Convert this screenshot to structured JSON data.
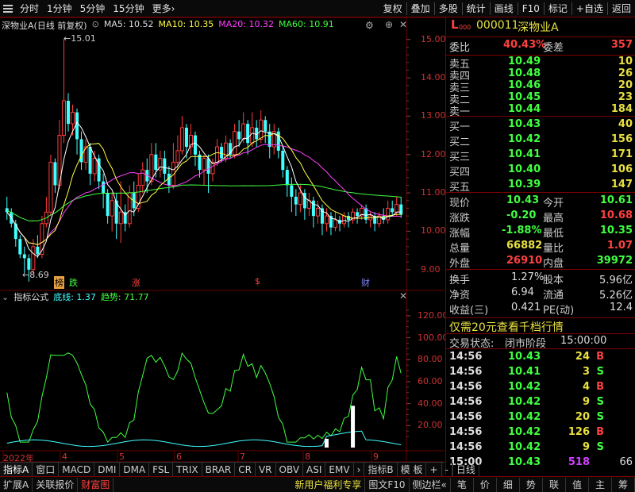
{
  "toolbar": {
    "left": [
      "分时",
      "1分钟",
      "5分钟",
      "15分钟",
      "更多"
    ],
    "more_arrow": "›",
    "right": [
      "复权",
      "叠加",
      "多股",
      "统计",
      "画线",
      "F10",
      "标记",
      "+自选",
      "返回"
    ]
  },
  "main_header": {
    "name": "深物业A(日线 前复权)",
    "ma5": "MA5: 10.52",
    "ma10": "MA10: 10.35",
    "ma20": "MA20: 10.32",
    "ma60": "MA60: 10.91"
  },
  "price_axis": [
    "15.00",
    "14.00",
    "13.00",
    "12.00",
    "11.00",
    "10.00",
    "9.00"
  ],
  "ind_axis": [
    "120.00",
    "100.00",
    "80.00",
    "60.00",
    "40.00",
    "20.00"
  ],
  "x_axis": [
    "2022年",
    "4",
    "5",
    "6",
    "7",
    "8",
    "9"
  ],
  "high_label": "15.01",
  "low_label": "8.69",
  "events": [
    {
      "text": "榜",
      "color": "#000",
      "bg": "#e8a040"
    },
    {
      "text": "跌",
      "color": "#40ff40",
      "bg": ""
    },
    {
      "text": "涨",
      "color": "#ff4040",
      "bg": ""
    },
    {
      "text": "$",
      "color": "#ff4040",
      "bg": ""
    },
    {
      "text": "财",
      "color": "#8080ff",
      "bg": ""
    }
  ],
  "indicator_header": {
    "name": "指标公式",
    "line1": "底线: 1.37",
    "line2": "趋势: 71.77"
  },
  "quote": {
    "code": "000011",
    "name": "深物业A",
    "tag": "L",
    "tag_sub": "000",
    "weibi_label": "委比",
    "weibi": "40.43%",
    "weicha_label": "委差",
    "weicha": "357",
    "sells": [
      {
        "label": "卖五",
        "price": "10.49",
        "vol": "10"
      },
      {
        "label": "卖四",
        "price": "10.48",
        "vol": "26"
      },
      {
        "label": "卖三",
        "price": "10.46",
        "vol": "20"
      },
      {
        "label": "卖二",
        "price": "10.45",
        "vol": "23"
      },
      {
        "label": "卖一",
        "price": "10.44",
        "vol": "184"
      }
    ],
    "buys": [
      {
        "label": "买一",
        "price": "10.43",
        "vol": "40"
      },
      {
        "label": "买二",
        "price": "10.42",
        "vol": "156"
      },
      {
        "label": "买三",
        "price": "10.41",
        "vol": "171"
      },
      {
        "label": "买四",
        "price": "10.40",
        "vol": "106"
      },
      {
        "label": "买五",
        "price": "10.39",
        "vol": "147"
      }
    ],
    "stats": [
      {
        "l1": "现价",
        "v1": "10.43",
        "c1": "#40ff40",
        "l2": "今开",
        "v2": "10.61",
        "c2": "#40ff40"
      },
      {
        "l1": "涨跌",
        "v1": "-0.20",
        "c1": "#40ff40",
        "l2": "最高",
        "v2": "10.68",
        "c2": "#ff4040"
      },
      {
        "l1": "涨幅",
        "v1": "-1.88%",
        "c1": "#40ff40",
        "l2": "最低",
        "v2": "10.35",
        "c2": "#40ff40"
      },
      {
        "l1": "总量",
        "v1": "66882",
        "c1": "#e8e040",
        "l2": "量比",
        "v2": "1.07",
        "c2": "#ff4040"
      },
      {
        "l1": "外盘",
        "v1": "26910",
        "c1": "#ff4040",
        "l2": "内盘",
        "v2": "39972",
        "c2": "#40ff40"
      }
    ],
    "stats2": [
      {
        "l1": "换手",
        "v1": "1.27%",
        "l2": "股本",
        "v2": "5.96亿"
      },
      {
        "l1": "净资",
        "v1": "6.94",
        "l2": "流通",
        "v2": "5.26亿"
      },
      {
        "l1": "收益(三)",
        "v1": "0.421",
        "l2": "PE(动)",
        "v2": "12.4"
      }
    ],
    "promo": "仅需20元查看千档行情",
    "trade_status_label": "交易状态:",
    "trade_status": "闭市阶段",
    "trade_time": "15:00:00",
    "ticks": [
      {
        "t": "14:56",
        "p": "10.43",
        "v": "24",
        "d": "B"
      },
      {
        "t": "14:56",
        "p": "10.41",
        "v": "3",
        "d": "S"
      },
      {
        "t": "14:56",
        "p": "10.42",
        "v": "4",
        "d": "B"
      },
      {
        "t": "14:56",
        "p": "10.42",
        "v": "9",
        "d": "S"
      },
      {
        "t": "14:56",
        "p": "10.42",
        "v": "20",
        "d": "S"
      },
      {
        "t": "14:56",
        "p": "10.42",
        "v": "126",
        "d": "B"
      },
      {
        "t": "14:56",
        "p": "10.42",
        "v": "9",
        "d": "S"
      },
      {
        "t": "15:00",
        "p": "10.43",
        "v": "518",
        "d": "",
        "extra": "66"
      }
    ]
  },
  "bottom1": [
    "指标A",
    "窗口",
    "MACD",
    "DMI",
    "DMA",
    "FSL",
    "TRIX",
    "BRAR",
    "CR",
    "VR",
    "OBV",
    "ASI",
    "EMV",
    "›",
    "指标B",
    "模 板",
    "+",
    "-",
    "日线"
  ],
  "bottom2_left": [
    "扩展A",
    "关联报价",
    "财富图"
  ],
  "bottom2_mid": [
    "新用户福利专享",
    "图文F10",
    "侧边栏«"
  ],
  "bottom2_right": [
    "笔",
    "价",
    "细",
    "势",
    "联",
    "值",
    "主",
    "筹"
  ],
  "colors": {
    "up": "#ff3c3c",
    "down": "#40ffff",
    "ma5": "#ffffff",
    "ma10": "#ffff40",
    "ma20": "#ff40ff",
    "ma60": "#40ff40",
    "grid": "#6a0000"
  },
  "chart_data": {
    "type": "candlestick",
    "price_ylim": [
      8.5,
      15.2
    ],
    "ind_ylim": [
      0,
      130
    ],
    "candles": [
      [
        10.6,
        10.5,
        10.9,
        10.3
      ],
      [
        10.5,
        10.2,
        10.6,
        10.1
      ],
      [
        10.2,
        9.8,
        10.3,
        9.6
      ],
      [
        9.8,
        9.4,
        9.9,
        9.3
      ],
      [
        9.4,
        9.3,
        9.6,
        8.9
      ],
      [
        9.3,
        9.0,
        9.4,
        8.69
      ],
      [
        9.0,
        9.6,
        9.8,
        8.9
      ],
      [
        9.6,
        9.4,
        9.9,
        9.3
      ],
      [
        9.4,
        10.2,
        10.4,
        9.3
      ],
      [
        10.2,
        10.5,
        10.9,
        10.1
      ],
      [
        10.5,
        11.8,
        12.0,
        10.4
      ],
      [
        11.8,
        11.2,
        11.9,
        11.0
      ],
      [
        11.2,
        12.5,
        12.9,
        11.1
      ],
      [
        12.5,
        13.4,
        15.01,
        12.3
      ],
      [
        13.4,
        12.8,
        13.6,
        12.6
      ],
      [
        12.8,
        13.1,
        13.3,
        12.5
      ],
      [
        13.1,
        12.4,
        13.2,
        12.0
      ],
      [
        12.4,
        11.8,
        12.6,
        11.6
      ],
      [
        11.8,
        12.2,
        12.4,
        11.6
      ],
      [
        12.2,
        11.5,
        12.3,
        11.2
      ],
      [
        11.5,
        11.9,
        12.1,
        11.3
      ],
      [
        11.9,
        11.3,
        12.0,
        11.1
      ],
      [
        11.3,
        11.0,
        11.5,
        10.6
      ],
      [
        11.0,
        10.4,
        11.1,
        10.2
      ],
      [
        10.4,
        10.8,
        11.0,
        10.0
      ],
      [
        10.8,
        10.2,
        11.0,
        9.8
      ],
      [
        10.2,
        10.5,
        11.3,
        9.7
      ],
      [
        10.5,
        10.2,
        10.7,
        10.0
      ],
      [
        10.2,
        11.0,
        11.2,
        10.1
      ],
      [
        11.0,
        10.6,
        11.3,
        10.4
      ],
      [
        10.6,
        11.2,
        11.5,
        10.5
      ],
      [
        11.2,
        11.6,
        11.8,
        11.0
      ],
      [
        11.6,
        11.3,
        11.9,
        11.0
      ],
      [
        11.3,
        12.0,
        12.3,
        11.2
      ],
      [
        12.0,
        11.6,
        12.3,
        11.4
      ],
      [
        11.6,
        11.9,
        12.1,
        11.4
      ],
      [
        11.9,
        11.5,
        12.1,
        11.3
      ],
      [
        11.5,
        11.2,
        11.7,
        11.0
      ],
      [
        11.2,
        11.8,
        12.3,
        11.1
      ],
      [
        11.8,
        12.1,
        12.5,
        11.6
      ],
      [
        12.1,
        12.7,
        13.0,
        12.0
      ],
      [
        12.7,
        12.2,
        12.8,
        11.9
      ],
      [
        12.2,
        12.5,
        12.8,
        12.0
      ],
      [
        12.5,
        12.0,
        12.6,
        11.7
      ],
      [
        12.0,
        11.6,
        12.1,
        11.4
      ],
      [
        11.6,
        11.9,
        12.0,
        11.2
      ],
      [
        11.9,
        11.5,
        12.0,
        11.0
      ],
      [
        11.5,
        11.8,
        11.9,
        11.3
      ],
      [
        11.8,
        12.2,
        12.4,
        11.7
      ],
      [
        12.2,
        11.9,
        12.3,
        11.8
      ],
      [
        11.9,
        12.3,
        12.5,
        11.8
      ],
      [
        12.3,
        12.0,
        12.4,
        11.9
      ],
      [
        12.0,
        12.6,
        12.8,
        11.9
      ],
      [
        12.6,
        12.4,
        12.9,
        12.2
      ],
      [
        12.4,
        12.8,
        13.1,
        12.3
      ],
      [
        12.8,
        12.3,
        12.9,
        12.0
      ],
      [
        12.3,
        12.7,
        13.1,
        12.2
      ],
      [
        12.7,
        12.4,
        12.9,
        12.2
      ],
      [
        12.4,
        12.9,
        13.15,
        12.3
      ],
      [
        12.9,
        12.6,
        13.0,
        12.3
      ],
      [
        12.6,
        12.2,
        12.8,
        11.9
      ],
      [
        12.2,
        12.6,
        12.8,
        12.0
      ],
      [
        12.6,
        12.1,
        12.7,
        11.9
      ],
      [
        12.1,
        11.6,
        12.2,
        11.4
      ],
      [
        11.6,
        11.2,
        11.7,
        10.9
      ],
      [
        11.2,
        10.9,
        11.4,
        10.5
      ],
      [
        10.9,
        10.7,
        11.1,
        10.4
      ],
      [
        10.7,
        11.0,
        11.2,
        10.5
      ],
      [
        11.0,
        10.6,
        11.1,
        10.3
      ],
      [
        10.6,
        10.8,
        11.0,
        10.4
      ],
      [
        10.8,
        10.4,
        10.9,
        10.1
      ],
      [
        10.4,
        10.6,
        10.8,
        10.2
      ],
      [
        10.6,
        10.2,
        10.7,
        9.9
      ],
      [
        10.2,
        10.4,
        10.6,
        10.0
      ],
      [
        10.4,
        10.1,
        10.5,
        9.9
      ],
      [
        10.1,
        10.3,
        10.5,
        10.0
      ],
      [
        10.3,
        10.2,
        10.4,
        10.0
      ],
      [
        10.2,
        10.4,
        10.5,
        10.1
      ],
      [
        10.4,
        10.3,
        10.5,
        10.1
      ],
      [
        10.3,
        10.5,
        10.6,
        10.2
      ],
      [
        10.5,
        10.4,
        10.6,
        10.2
      ],
      [
        10.4,
        10.6,
        10.7,
        10.3
      ],
      [
        10.6,
        10.3,
        10.7,
        10.2
      ],
      [
        10.3,
        10.4,
        10.5,
        10.1
      ],
      [
        10.4,
        10.2,
        10.5,
        10.0
      ],
      [
        10.2,
        10.4,
        10.5,
        10.1
      ],
      [
        10.4,
        10.3,
        10.6,
        10.2
      ],
      [
        10.3,
        10.6,
        10.8,
        10.2
      ],
      [
        10.6,
        10.5,
        10.8,
        10.4
      ],
      [
        10.5,
        10.7,
        10.9,
        10.4
      ],
      [
        10.7,
        10.43,
        10.9,
        10.35
      ]
    ],
    "bars": [
      [
        73,
        8
      ],
      [
        79,
        38
      ]
    ]
  }
}
